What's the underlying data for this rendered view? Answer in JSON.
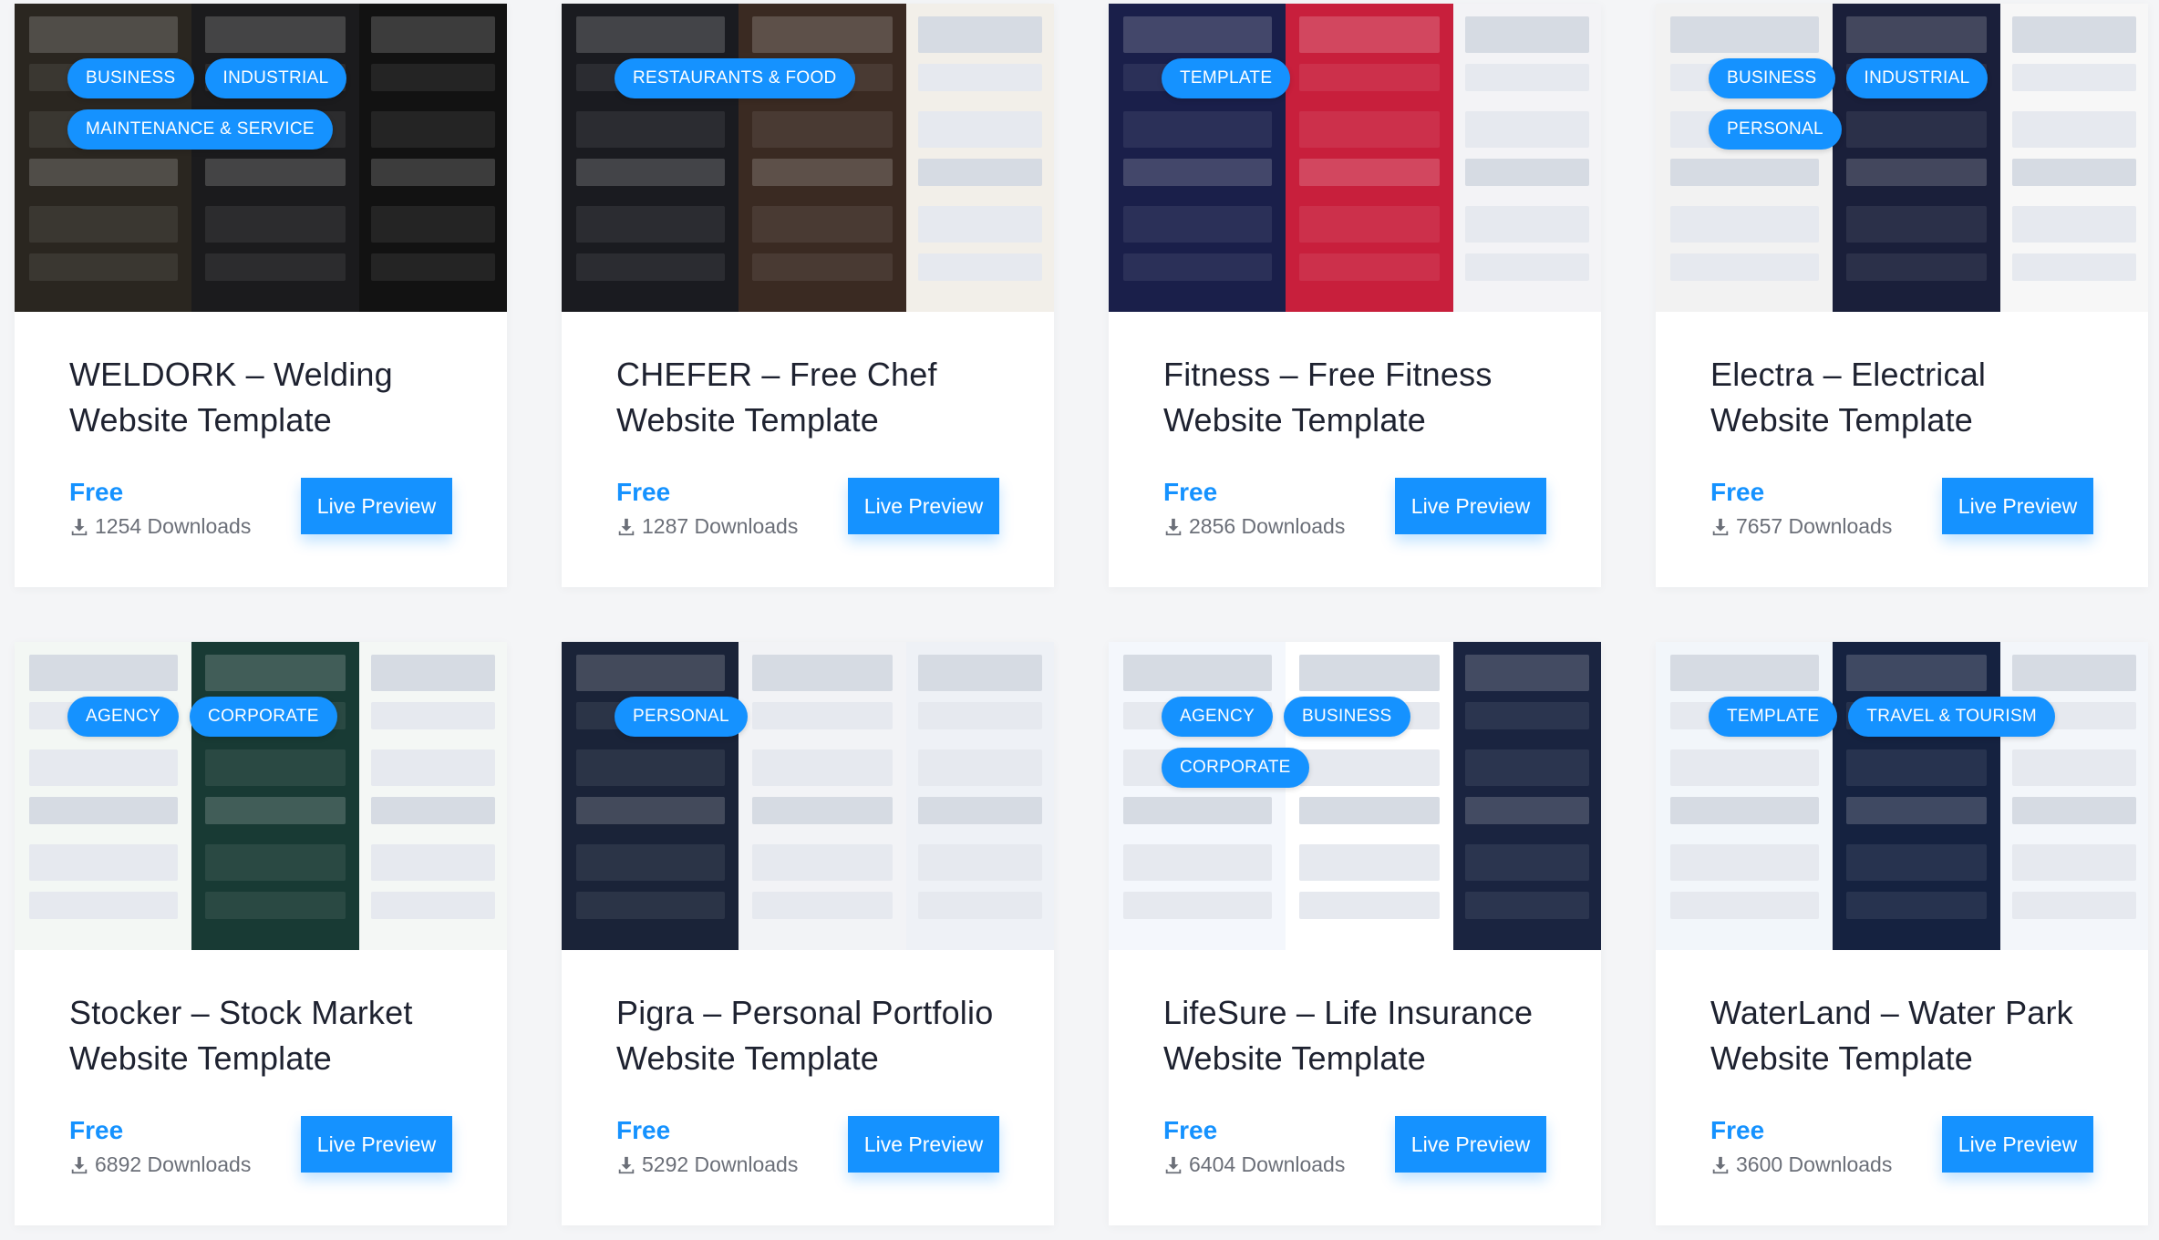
{
  "cards": [
    {
      "tags": [
        "BUSINESS",
        "INDUSTRIAL",
        "MAINTENANCE & SERVICE"
      ],
      "title": "WELDORK – Welding Website Template",
      "price": "Free",
      "downloads": "1254 Downloads",
      "button": "Live Preview",
      "theme": [
        "#2a2620",
        "#1b1b1d",
        "#121212"
      ]
    },
    {
      "tags": [
        "RESTAURANTS & FOOD"
      ],
      "title": "CHEFER – Free Chef Website Template",
      "price": "Free",
      "downloads": "1287 Downloads",
      "button": "Live Preview",
      "theme": [
        "#1a1b20",
        "#3a2a22",
        "#f2efe9"
      ]
    },
    {
      "tags": [
        "TEMPLATE"
      ],
      "title": "Fitness – Free Fitness Website Template",
      "price": "Free",
      "downloads": "2856 Downloads",
      "button": "Live Preview",
      "theme": [
        "#1a1f4a",
        "#c81f3c",
        "#f3f3f6"
      ]
    },
    {
      "tags": [
        "BUSINESS",
        "INDUSTRIAL",
        "PERSONAL"
      ],
      "title": "Electra – Electrical Website Template",
      "price": "Free",
      "downloads": "7657 Downloads",
      "button": "Live Preview",
      "theme": [
        "#f2f2f2",
        "#1a1f3a",
        "#f7f7f7"
      ]
    },
    {
      "tags": [
        "AGENCY",
        "CORPORATE"
      ],
      "title": "Stocker – Stock Market Website Template",
      "price": "Free",
      "downloads": "6892 Downloads",
      "button": "Live Preview",
      "theme": [
        "#f3f7f4",
        "#183a34",
        "#f4f7f5"
      ]
    },
    {
      "tags": [
        "PERSONAL"
      ],
      "title": "Pigra – Personal Portfolio Website Template",
      "price": "Free",
      "downloads": "5292 Downloads",
      "button": "Live Preview",
      "theme": [
        "#1a2338",
        "#f2f3f6",
        "#eef1f6"
      ]
    },
    {
      "tags": [
        "AGENCY",
        "BUSINESS",
        "CORPORATE"
      ],
      "title": "LifeSure – Life Insurance Website Template",
      "price": "Free",
      "downloads": "6404 Downloads",
      "button": "Live Preview",
      "theme": [
        "#f4f7fc",
        "#ffffff",
        "#1a2440"
      ]
    },
    {
      "tags": [
        "TEMPLATE",
        "TRAVEL & TOURISM"
      ],
      "title": "WaterLand – Water Park Website Template",
      "price": "Free",
      "downloads": "3600 Downloads",
      "button": "Live Preview",
      "theme": [
        "#f2f6fa",
        "#152240",
        "#f3f6fa"
      ]
    }
  ],
  "colors": {
    "accent": "#1592ff",
    "title": "#1e2230",
    "muted": "#6b6f78",
    "background": "#f4f5f7"
  },
  "icons": {
    "download": "download-icon"
  }
}
